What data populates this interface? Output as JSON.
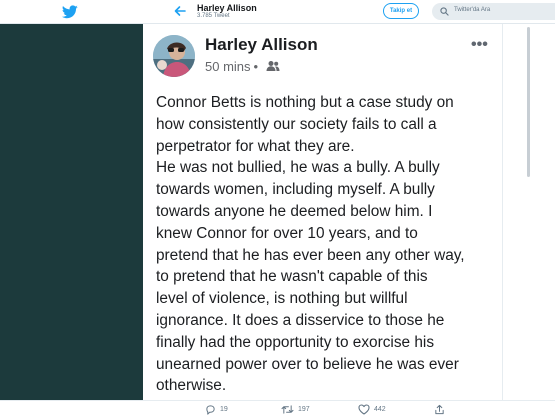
{
  "header": {
    "name": "Harley Allison",
    "tweet_count": "3.785 Tweet",
    "follow_label": "Takip et",
    "search_placeholder": "Twitter'da Ara"
  },
  "post": {
    "author": "Harley Allison",
    "timestamp": "50 mins",
    "separator": "•",
    "text": "Connor Betts is nothing but a case study on\nhow consistently our society fails to call a\nperpetrator for what they are.\nHe was not bullied, he was a bully. A bully\ntowards women, including myself.  A bully\ntowards anyone he deemed below him. I\nknew Connor for over 10 years, and to\npretend that he has ever been any other way,\nto pretend that he wasn't capable of this\nlevel of violence, is nothing but willful\nignorance. It does a disservice to those he\nfinally had the opportunity to exorcise his\nunearned power over to believe he was ever\notherwise.",
    "more_label": "•••"
  },
  "actions": {
    "replies": "19",
    "retweets": "197",
    "likes": "442"
  },
  "colors": {
    "background": "#1c3a3c",
    "twitter_blue": "#1da1f2"
  },
  "icons": [
    "twitter-bird-icon",
    "back-arrow-icon",
    "search-icon",
    "friends-icon",
    "more-icon",
    "reply-icon",
    "retweet-icon",
    "like-icon",
    "share-icon"
  ]
}
